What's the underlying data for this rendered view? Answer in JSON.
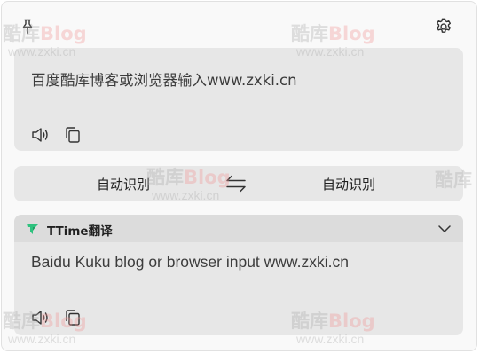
{
  "toolbar": {
    "pin_icon": "pin-icon",
    "settings_icon": "gear-icon"
  },
  "source": {
    "text": "百度酷库博客或浏览器输入www.zxki.cn",
    "speak_icon": "speaker-icon",
    "copy_icon": "copy-icon"
  },
  "languages": {
    "from": "自动识别",
    "swap_icon": "swap-arrows-icon",
    "to": "自动识别"
  },
  "result": {
    "engine_name": "TTime翻译",
    "engine_logo_color": "#2ec27e",
    "collapse_icon": "chevron-down-icon",
    "text": "Baidu Kuku blog or browser input www.zxki.cn",
    "speak_icon": "speaker-icon",
    "copy_icon": "copy-icon"
  },
  "watermark": {
    "brand_cn": "酷库",
    "brand_latin": "Blog",
    "url": "www.zxki.cn"
  }
}
